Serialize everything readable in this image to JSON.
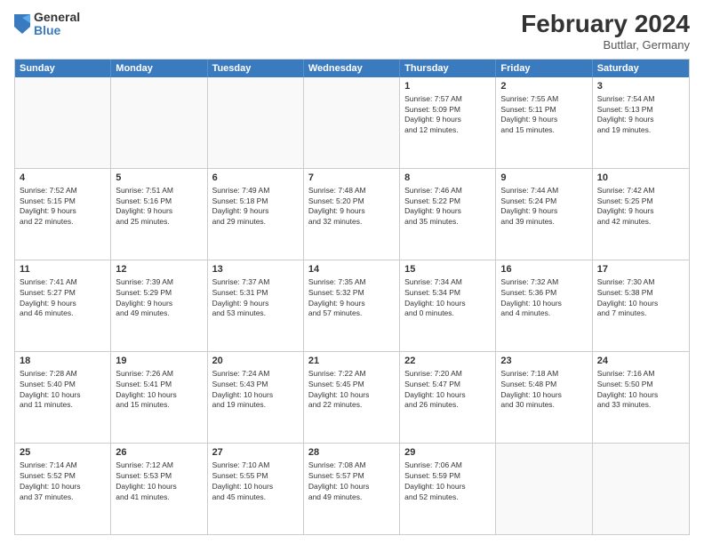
{
  "logo": {
    "general": "General",
    "blue": "Blue"
  },
  "header": {
    "title": "February 2024",
    "subtitle": "Buttlar, Germany"
  },
  "days_of_week": [
    "Sunday",
    "Monday",
    "Tuesday",
    "Wednesday",
    "Thursday",
    "Friday",
    "Saturday"
  ],
  "weeks": [
    [
      {
        "day": "",
        "info": ""
      },
      {
        "day": "",
        "info": ""
      },
      {
        "day": "",
        "info": ""
      },
      {
        "day": "",
        "info": ""
      },
      {
        "day": "1",
        "info": "Sunrise: 7:57 AM\nSunset: 5:09 PM\nDaylight: 9 hours\nand 12 minutes."
      },
      {
        "day": "2",
        "info": "Sunrise: 7:55 AM\nSunset: 5:11 PM\nDaylight: 9 hours\nand 15 minutes."
      },
      {
        "day": "3",
        "info": "Sunrise: 7:54 AM\nSunset: 5:13 PM\nDaylight: 9 hours\nand 19 minutes."
      }
    ],
    [
      {
        "day": "4",
        "info": "Sunrise: 7:52 AM\nSunset: 5:15 PM\nDaylight: 9 hours\nand 22 minutes."
      },
      {
        "day": "5",
        "info": "Sunrise: 7:51 AM\nSunset: 5:16 PM\nDaylight: 9 hours\nand 25 minutes."
      },
      {
        "day": "6",
        "info": "Sunrise: 7:49 AM\nSunset: 5:18 PM\nDaylight: 9 hours\nand 29 minutes."
      },
      {
        "day": "7",
        "info": "Sunrise: 7:48 AM\nSunset: 5:20 PM\nDaylight: 9 hours\nand 32 minutes."
      },
      {
        "day": "8",
        "info": "Sunrise: 7:46 AM\nSunset: 5:22 PM\nDaylight: 9 hours\nand 35 minutes."
      },
      {
        "day": "9",
        "info": "Sunrise: 7:44 AM\nSunset: 5:24 PM\nDaylight: 9 hours\nand 39 minutes."
      },
      {
        "day": "10",
        "info": "Sunrise: 7:42 AM\nSunset: 5:25 PM\nDaylight: 9 hours\nand 42 minutes."
      }
    ],
    [
      {
        "day": "11",
        "info": "Sunrise: 7:41 AM\nSunset: 5:27 PM\nDaylight: 9 hours\nand 46 minutes."
      },
      {
        "day": "12",
        "info": "Sunrise: 7:39 AM\nSunset: 5:29 PM\nDaylight: 9 hours\nand 49 minutes."
      },
      {
        "day": "13",
        "info": "Sunrise: 7:37 AM\nSunset: 5:31 PM\nDaylight: 9 hours\nand 53 minutes."
      },
      {
        "day": "14",
        "info": "Sunrise: 7:35 AM\nSunset: 5:32 PM\nDaylight: 9 hours\nand 57 minutes."
      },
      {
        "day": "15",
        "info": "Sunrise: 7:34 AM\nSunset: 5:34 PM\nDaylight: 10 hours\nand 0 minutes."
      },
      {
        "day": "16",
        "info": "Sunrise: 7:32 AM\nSunset: 5:36 PM\nDaylight: 10 hours\nand 4 minutes."
      },
      {
        "day": "17",
        "info": "Sunrise: 7:30 AM\nSunset: 5:38 PM\nDaylight: 10 hours\nand 7 minutes."
      }
    ],
    [
      {
        "day": "18",
        "info": "Sunrise: 7:28 AM\nSunset: 5:40 PM\nDaylight: 10 hours\nand 11 minutes."
      },
      {
        "day": "19",
        "info": "Sunrise: 7:26 AM\nSunset: 5:41 PM\nDaylight: 10 hours\nand 15 minutes."
      },
      {
        "day": "20",
        "info": "Sunrise: 7:24 AM\nSunset: 5:43 PM\nDaylight: 10 hours\nand 19 minutes."
      },
      {
        "day": "21",
        "info": "Sunrise: 7:22 AM\nSunset: 5:45 PM\nDaylight: 10 hours\nand 22 minutes."
      },
      {
        "day": "22",
        "info": "Sunrise: 7:20 AM\nSunset: 5:47 PM\nDaylight: 10 hours\nand 26 minutes."
      },
      {
        "day": "23",
        "info": "Sunrise: 7:18 AM\nSunset: 5:48 PM\nDaylight: 10 hours\nand 30 minutes."
      },
      {
        "day": "24",
        "info": "Sunrise: 7:16 AM\nSunset: 5:50 PM\nDaylight: 10 hours\nand 33 minutes."
      }
    ],
    [
      {
        "day": "25",
        "info": "Sunrise: 7:14 AM\nSunset: 5:52 PM\nDaylight: 10 hours\nand 37 minutes."
      },
      {
        "day": "26",
        "info": "Sunrise: 7:12 AM\nSunset: 5:53 PM\nDaylight: 10 hours\nand 41 minutes."
      },
      {
        "day": "27",
        "info": "Sunrise: 7:10 AM\nSunset: 5:55 PM\nDaylight: 10 hours\nand 45 minutes."
      },
      {
        "day": "28",
        "info": "Sunrise: 7:08 AM\nSunset: 5:57 PM\nDaylight: 10 hours\nand 49 minutes."
      },
      {
        "day": "29",
        "info": "Sunrise: 7:06 AM\nSunset: 5:59 PM\nDaylight: 10 hours\nand 52 minutes."
      },
      {
        "day": "",
        "info": ""
      },
      {
        "day": "",
        "info": ""
      }
    ]
  ]
}
